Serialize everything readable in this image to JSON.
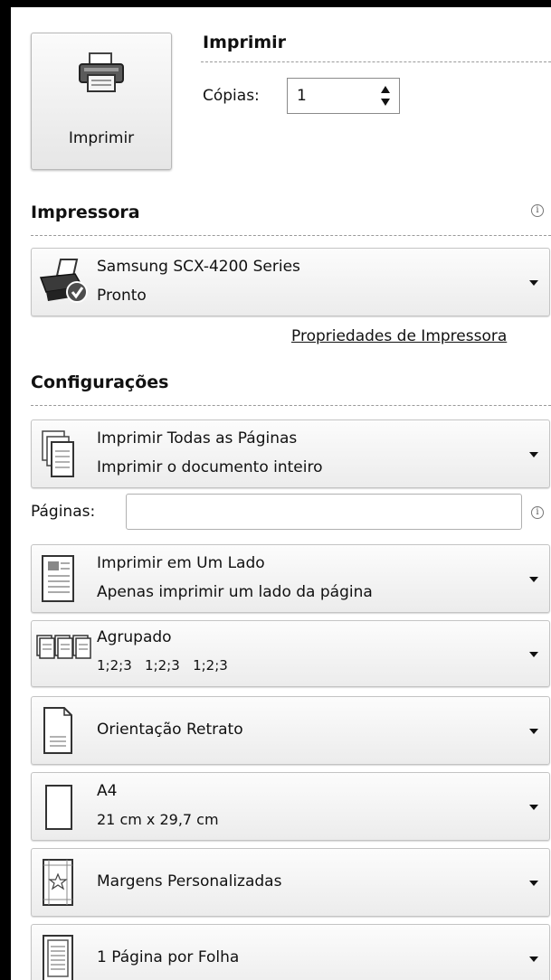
{
  "print_section": {
    "title": "Imprimir",
    "button_label": "Imprimir",
    "copies_label": "Cópias:",
    "copies_value": "1"
  },
  "printer": {
    "title": "Impressora",
    "name": "Samsung SCX-4200 Series",
    "status": "Pronto",
    "properties_link": "Propriedades de Impressora"
  },
  "settings": {
    "title": "Configurações",
    "pages_label": "Páginas:",
    "pages_value": "",
    "options": [
      {
        "line1": "Imprimir Todas as Páginas",
        "line2": "Imprimir o documento inteiro",
        "icon": "pages-stack-icon"
      },
      {
        "line1": "Imprimir em Um Lado",
        "line2": "Apenas imprimir um lado da página",
        "icon": "one-sided-icon"
      },
      {
        "line1": "Agrupado",
        "line2": "1;2;3   1;2;3   1;2;3",
        "icon": "collated-icon"
      },
      {
        "line1": "Orientação Retrato",
        "line2": "",
        "icon": "portrait-page-icon"
      },
      {
        "line1": "A4",
        "line2": "21 cm x 29,7 cm",
        "icon": "paper-size-icon"
      },
      {
        "line1": "Margens Personalizadas",
        "line2": "",
        "icon": "custom-margins-icon"
      },
      {
        "line1": "1 Página por Folha",
        "line2": "",
        "icon": "pages-per-sheet-icon"
      }
    ]
  }
}
